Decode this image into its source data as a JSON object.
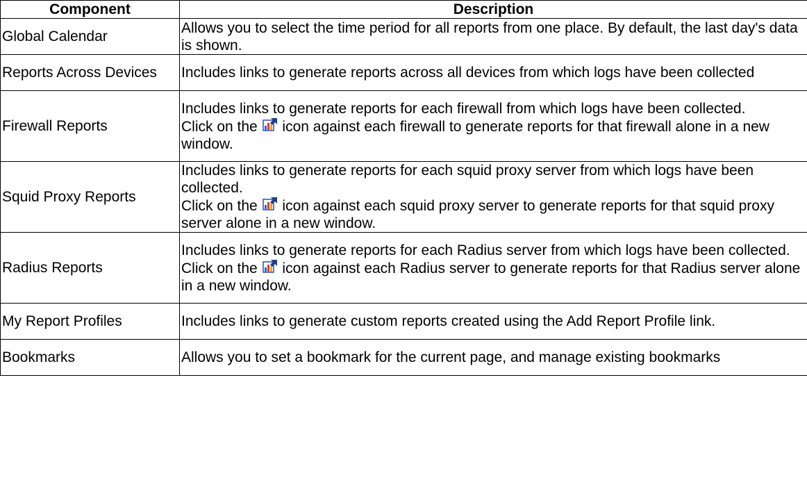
{
  "table": {
    "headers": [
      "Component",
      "Description"
    ],
    "rows": [
      {
        "component": "Global Calendar",
        "lines": [
          "Allows you to select the time period for all reports from one place. By default, the last day's data is shown."
        ]
      },
      {
        "component": "Reports Across Devices",
        "lines": [
          "Includes links to generate reports across all devices from which logs have been collected"
        ]
      },
      {
        "component": "Firewall Reports",
        "lines": [
          "Includes links to generate reports for each firewall from which logs have been collected."
        ],
        "click_prefix": "Click on the",
        "click_suffix": "icon against each firewall to generate reports for that firewall alone in a new window."
      },
      {
        "component": "Squid Proxy Reports",
        "lines": [
          "Includes links to generate reports for each squid proxy server from which logs have been collected."
        ],
        "click_prefix": "Click on the",
        "click_suffix": "icon against each squid proxy server to generate reports for that squid proxy server alone in a new window."
      },
      {
        "component": "Radius Reports",
        "lines": [
          "Includes links to generate reports for each Radius server from which logs have been collected."
        ],
        "click_prefix": "Click on the",
        "click_suffix": "icon against each Radius server to generate reports for that Radius server alone in a new window."
      },
      {
        "component": "My Report Profiles",
        "lines": [
          "Includes links to generate custom reports created using the Add Report Profile link."
        ]
      },
      {
        "component": "Bookmarks",
        "lines": [
          "Allows you to set a bookmark for the current page, and manage existing bookmarks"
        ]
      }
    ],
    "icon": "report-popout-icon"
  }
}
